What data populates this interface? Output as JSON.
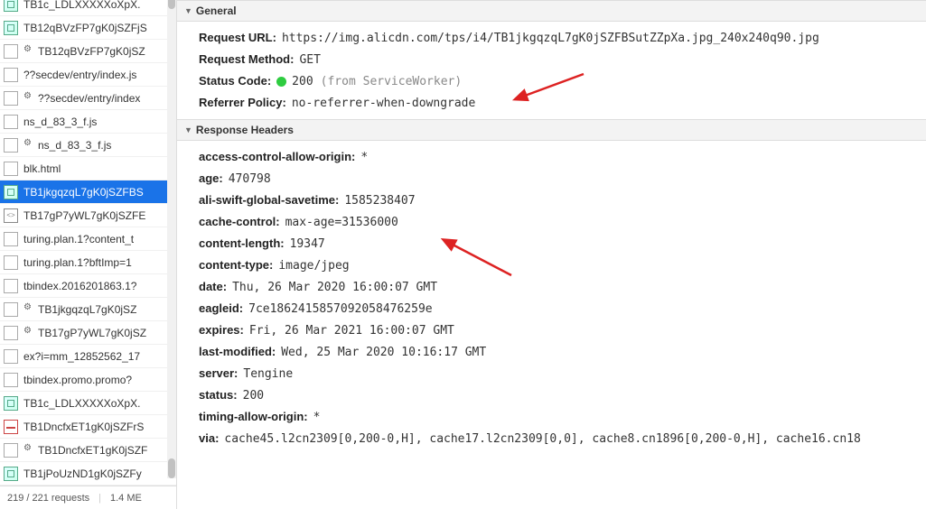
{
  "requests": [
    {
      "name": "TB1c_LDLXXXXXoXpX.",
      "icon": "image",
      "gear": false
    },
    {
      "name": "TB12qBVzFP7gK0jSZFjS",
      "icon": "image",
      "gear": false
    },
    {
      "name": "TB12qBVzFP7gK0jSZ",
      "icon": "other",
      "gear": true
    },
    {
      "name": "??secdev/entry/index.js",
      "icon": "other",
      "gear": false
    },
    {
      "name": "??secdev/entry/index",
      "icon": "other",
      "gear": true
    },
    {
      "name": "ns_d_83_3_f.js",
      "icon": "other",
      "gear": false
    },
    {
      "name": "ns_d_83_3_f.js",
      "icon": "other",
      "gear": true
    },
    {
      "name": "blk.html",
      "icon": "other",
      "gear": false
    },
    {
      "name": "TB1jkgqzqL7gK0jSZFBS",
      "icon": "image",
      "gear": false,
      "selected": true
    },
    {
      "name": "TB17gP7yWL7gK0jSZFE",
      "icon": "html",
      "gear": false
    },
    {
      "name": "turing.plan.1?content_t",
      "icon": "other",
      "gear": false
    },
    {
      "name": "turing.plan.1?bftImp=1",
      "icon": "other",
      "gear": false
    },
    {
      "name": "tbindex.2016201863.1?",
      "icon": "other",
      "gear": false
    },
    {
      "name": "TB1jkgqzqL7gK0jSZ",
      "icon": "other",
      "gear": true
    },
    {
      "name": "TB17gP7yWL7gK0jSZ",
      "icon": "other",
      "gear": true
    },
    {
      "name": "ex?i=mm_12852562_17",
      "icon": "other",
      "gear": false
    },
    {
      "name": "tbindex.promo.promo?",
      "icon": "other",
      "gear": false
    },
    {
      "name": "TB1c_LDLXXXXXoXpX.",
      "icon": "image",
      "gear": false
    },
    {
      "name": "TB1DncfxET1gK0jSZFrS",
      "icon": "pdf",
      "gear": false
    },
    {
      "name": "TB1DncfxET1gK0jSZF",
      "icon": "other",
      "gear": true
    },
    {
      "name": "TB1jPoUzND1gK0jSZFy",
      "icon": "image",
      "gear": false
    }
  ],
  "statusbar": {
    "left": "219 / 221 requests",
    "right": "1.4 ME"
  },
  "sections": {
    "general": {
      "title": "General",
      "request_url_label": "Request URL:",
      "request_url_value": "https://img.alicdn.com/tps/i4/TB1jkgqzqL7gK0jSZFBSutZZpXa.jpg_240x240q90.jpg",
      "request_method_label": "Request Method:",
      "request_method_value": "GET",
      "status_code_label": "Status Code:",
      "status_code_value": "200",
      "status_code_extra": "(from ServiceWorker)",
      "referrer_policy_label": "Referrer Policy:",
      "referrer_policy_value": "no-referrer-when-downgrade"
    },
    "response": {
      "title": "Response Headers",
      "headers": [
        {
          "k": "access-control-allow-origin:",
          "v": "*"
        },
        {
          "k": "age:",
          "v": "470798"
        },
        {
          "k": "ali-swift-global-savetime:",
          "v": "1585238407"
        },
        {
          "k": "cache-control:",
          "v": "max-age=31536000"
        },
        {
          "k": "content-length:",
          "v": "19347"
        },
        {
          "k": "content-type:",
          "v": "image/jpeg"
        },
        {
          "k": "date:",
          "v": "Thu, 26 Mar 2020 16:00:07 GMT"
        },
        {
          "k": "eagleid:",
          "v": "7ce1862415857092058476259e"
        },
        {
          "k": "expires:",
          "v": "Fri, 26 Mar 2021 16:00:07 GMT"
        },
        {
          "k": "last-modified:",
          "v": "Wed, 25 Mar 2020 10:16:17 GMT"
        },
        {
          "k": "server:",
          "v": "Tengine"
        },
        {
          "k": "status:",
          "v": "200"
        },
        {
          "k": "timing-allow-origin:",
          "v": "*"
        },
        {
          "k": "via:",
          "v": "cache45.l2cn2309[0,200-0,H], cache17.l2cn2309[0,0], cache8.cn1896[0,200-0,H], cache16.cn18"
        }
      ]
    }
  }
}
